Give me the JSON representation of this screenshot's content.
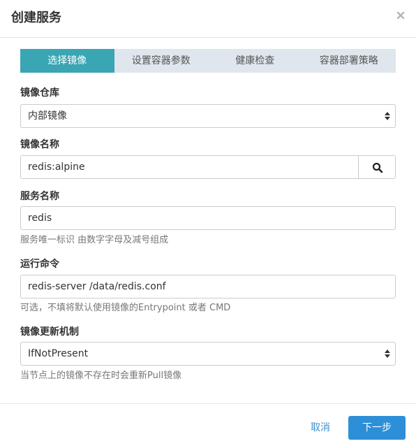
{
  "dialog": {
    "title": "创建服务"
  },
  "steps": [
    {
      "label": "选择镜像",
      "active": true
    },
    {
      "label": "设置容器参数",
      "active": false
    },
    {
      "label": "健康检查",
      "active": false
    },
    {
      "label": "容器部署策略",
      "active": false
    }
  ],
  "form": {
    "registry": {
      "label": "镜像仓库",
      "value": "内部镜像"
    },
    "image_name": {
      "label": "镜像名称",
      "value": "redis:alpine",
      "button_icon": "search-icon"
    },
    "service_name": {
      "label": "服务名称",
      "value": "redis",
      "help": "服务唯一标识 由数字字母及减号组成"
    },
    "command": {
      "label": "运行命令",
      "value": "redis-server /data/redis.conf",
      "help": "可选，不填将默认使用镜像的Entrypoint 或者 CMD"
    },
    "pull_policy": {
      "label": "镜像更新机制",
      "value": "IfNotPresent",
      "help": "当节点上的镜像不存在时会重新Pull镜像"
    }
  },
  "footer": {
    "cancel_label": "取消",
    "next_label": "下一步"
  },
  "colors": {
    "step_active": "#3aa5b3",
    "step_inactive": "#dfe6ed",
    "primary": "#2d8fd8",
    "link": "#3a8fd0"
  }
}
